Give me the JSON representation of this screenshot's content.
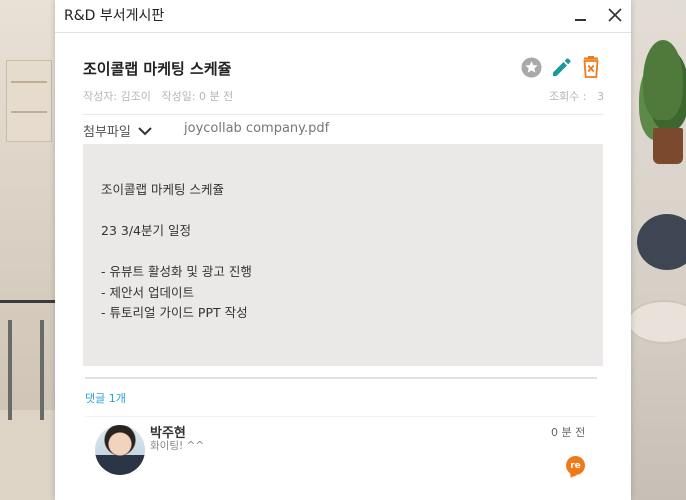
{
  "window": {
    "title": "R&D 부서게시판",
    "minimize_icon": "minimize-icon",
    "close_icon": "close-icon"
  },
  "post": {
    "title": "조이콜랩 마케팅 스케쥴",
    "author_label": "작성자: 김조이",
    "date_label": "작성일: 0 분 전",
    "views_label": "조회수 :",
    "views_count": "3",
    "actions": [
      {
        "name": "favorite",
        "icon": "star-icon",
        "color": "#a9a9a9"
      },
      {
        "name": "edit",
        "icon": "pencil-icon",
        "color": "#1a9a9a"
      },
      {
        "name": "delete",
        "icon": "trash-icon",
        "color": "#f07a1a"
      }
    ]
  },
  "attachments": {
    "label": "첨부파일",
    "file_name": "joycollab company.pdf"
  },
  "content": {
    "lines": [
      "조이콜랩 마케팅 스케쥴",
      "",
      "23 3/4분기 일정",
      "",
      "- 유뷰트 활성화 및 광고 진행",
      "- 제안서 업데이트",
      "- 튜토리얼 가이드 PPT 작성"
    ]
  },
  "comments": {
    "count_label": "댓글 1개",
    "items": [
      {
        "author": "박주현",
        "text": "화이팅! ^^",
        "time": "0 분 전",
        "reply_label": "re"
      }
    ]
  },
  "colors": {
    "accent": "#2a9fd6",
    "content_bg": "#ebe8e8",
    "reply": "#f07a1a"
  }
}
